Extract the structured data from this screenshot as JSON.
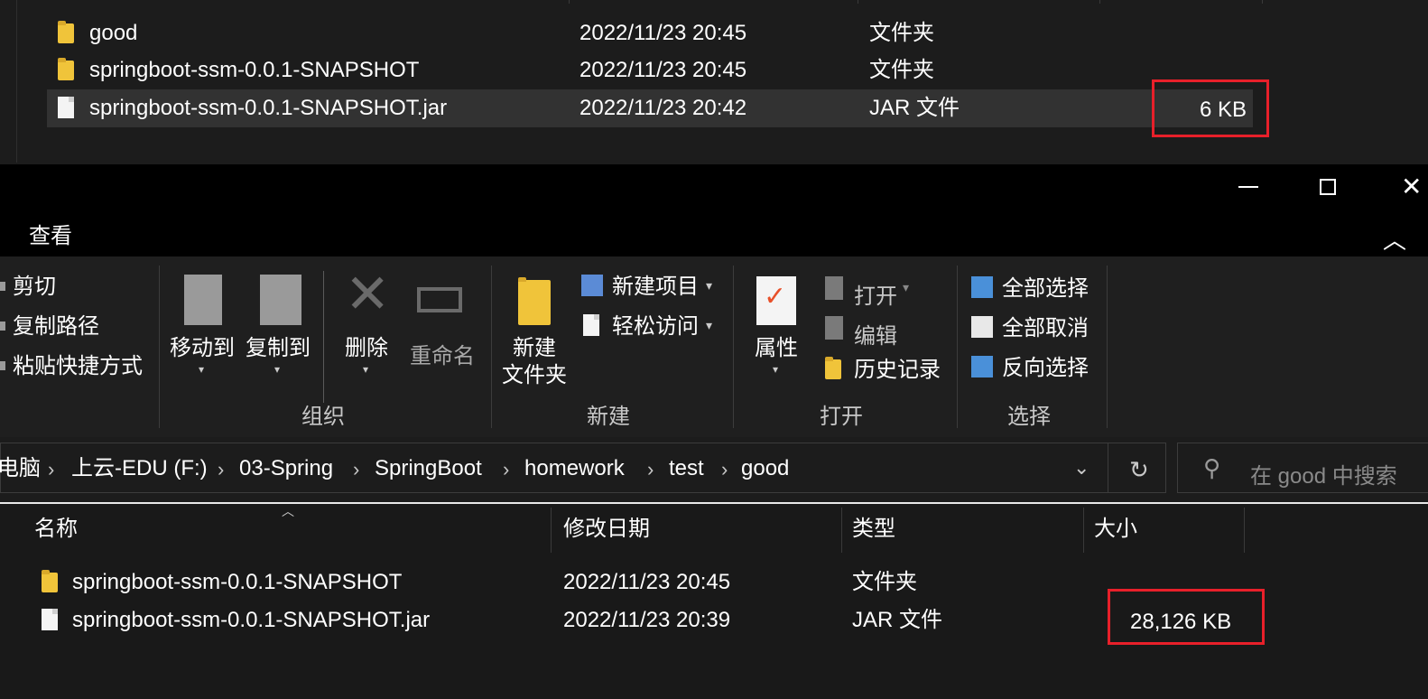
{
  "top_window": {
    "rows": [
      {
        "name": "good",
        "modified": "2022/11/23 20:45",
        "type": "文件夹",
        "size": "",
        "icon": "folder-icon"
      },
      {
        "name": "springboot-ssm-0.0.1-SNAPSHOT",
        "modified": "2022/11/23 20:45",
        "type": "文件夹",
        "size": "",
        "icon": "folder-icon"
      },
      {
        "name": "springboot-ssm-0.0.1-SNAPSHOT.jar",
        "modified": "2022/11/23 20:42",
        "type": "JAR 文件",
        "size": "6 KB",
        "icon": "file-icon",
        "selected": true
      }
    ]
  },
  "window_controls": {
    "minimize": "—",
    "maximize": "☐",
    "close": "✕"
  },
  "ribbon_tab": "查看",
  "ribbon": {
    "clipboard": {
      "cut": "剪切",
      "copy_path": "复制路径",
      "paste_shortcut": "粘贴快捷方式"
    },
    "organize": {
      "label": "组织",
      "move_to": "移动到",
      "copy_to": "复制到",
      "delete": "删除",
      "rename": "重命名"
    },
    "new": {
      "label": "新建",
      "new_folder_1": "新建",
      "new_folder_2": "文件夹",
      "new_item": "新建项目",
      "easy_access": "轻松访问"
    },
    "open": {
      "label": "打开",
      "properties": "属性",
      "open": "打开",
      "edit": "编辑",
      "history": "历史记录"
    },
    "select": {
      "label": "选择",
      "select_all": "全部选择",
      "select_none": "全部取消",
      "invert": "反向选择"
    }
  },
  "address": {
    "crumbs": [
      "电脑",
      "上云-EDU (F:)",
      "03-Spring",
      "SpringBoot",
      "homework",
      "test",
      "good"
    ]
  },
  "search": {
    "placeholder": "在 good 中搜索"
  },
  "list": {
    "headers": {
      "name": "名称",
      "modified": "修改日期",
      "type": "类型",
      "size": "大小"
    },
    "rows": [
      {
        "name": "springboot-ssm-0.0.1-SNAPSHOT",
        "modified": "2022/11/23 20:45",
        "type": "文件夹",
        "size": "",
        "icon": "folder-icon"
      },
      {
        "name": "springboot-ssm-0.0.1-SNAPSHOT.jar",
        "modified": "2022/11/23 20:39",
        "type": "JAR 文件",
        "size": "28,126 KB",
        "icon": "file-icon"
      }
    ]
  },
  "colors": {
    "highlight_box": "#e8202a",
    "folder": "#f0c43a",
    "background": "#1c1c1c"
  }
}
